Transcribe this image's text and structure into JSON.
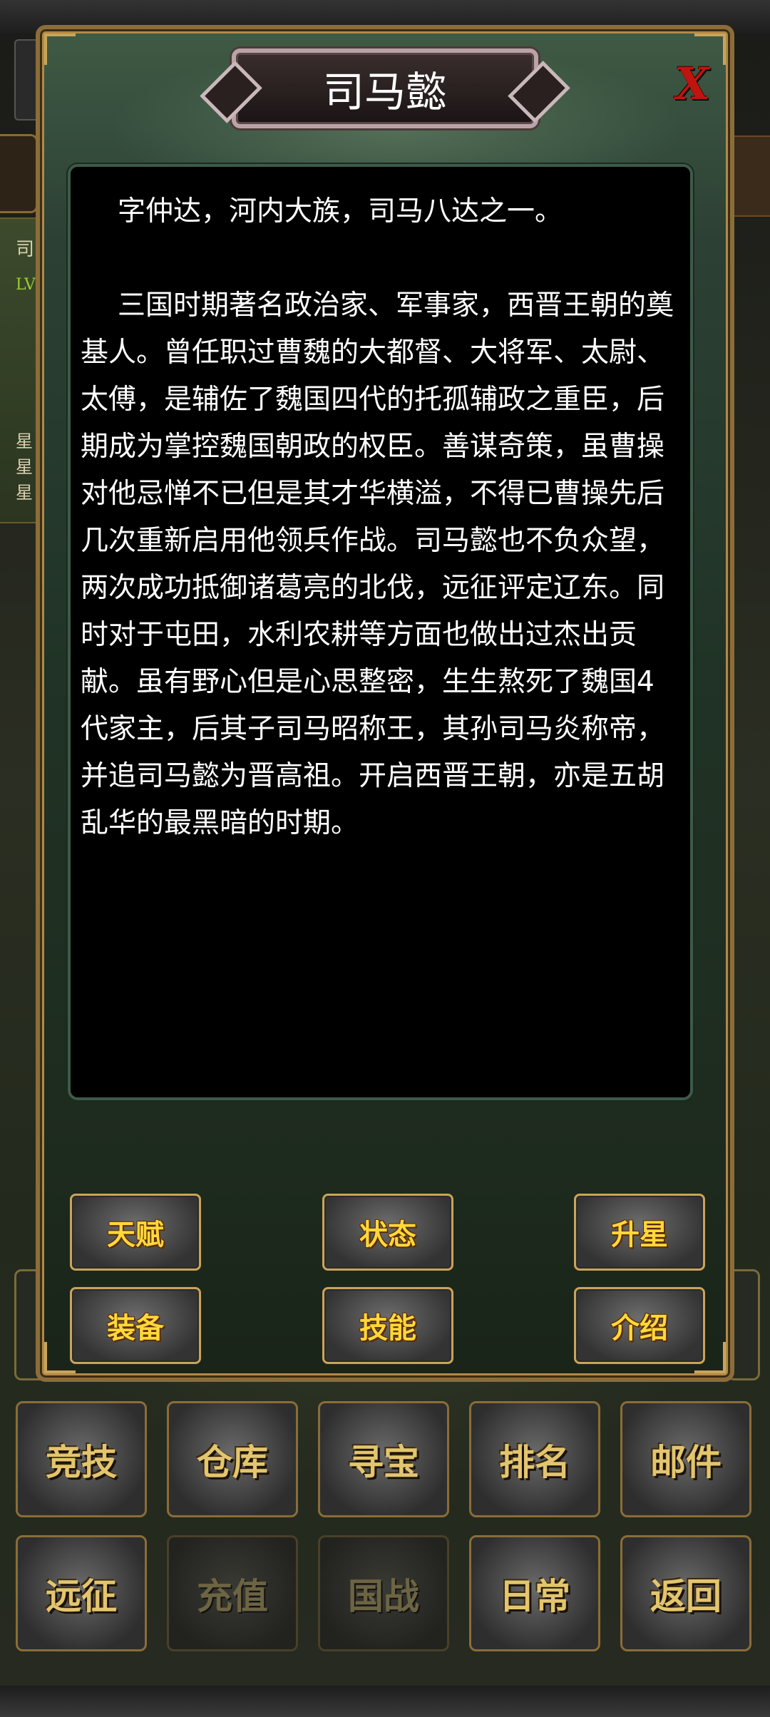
{
  "dialog": {
    "title": "司马懿",
    "close_label": "X",
    "bio": [
      "字仲达，河内大族，司马八达之一。",
      "三国时期著名政治家、军事家，西晋王朝的奠基人。曾任职过曹魏的大都督、大将军、太尉、太傅，是辅佐了魏国四代的托孤辅政之重臣，后期成为掌控魏国朝政的权臣。善谋奇策，虽曹操对他忌惮不已但是其才华横溢，不得已曹操先后几次重新启用他领兵作战。司马懿也不负众望，两次成功抵御诸葛亮的北伐，远征评定辽东。同时对于屯田，水利农耕等方面也做出过杰出贡献。虽有野心但是心思整密，生生熬死了魏国4代家主，后其子司马昭称王，其孙司马炎称帝，并追司马懿为晋高祖。开启西晋王朝，亦是五胡乱华的最黑暗的时期。"
    ],
    "buttons": {
      "talent": "天赋",
      "status": "状态",
      "star_up": "升星",
      "equipment": "装备",
      "skill": "技能",
      "intro": "介绍"
    }
  },
  "bottom_menu": {
    "arena": "竞技",
    "warehouse": "仓库",
    "treasure": "寻宝",
    "ranking": "排名",
    "mail": "邮件",
    "expedition": "远征",
    "recharge": "充值",
    "nation_war": "国战",
    "daily": "日常",
    "back": "返回"
  },
  "background_panel": {
    "chars": [
      "司",
      "LV",
      "星",
      "星",
      "星"
    ]
  }
}
